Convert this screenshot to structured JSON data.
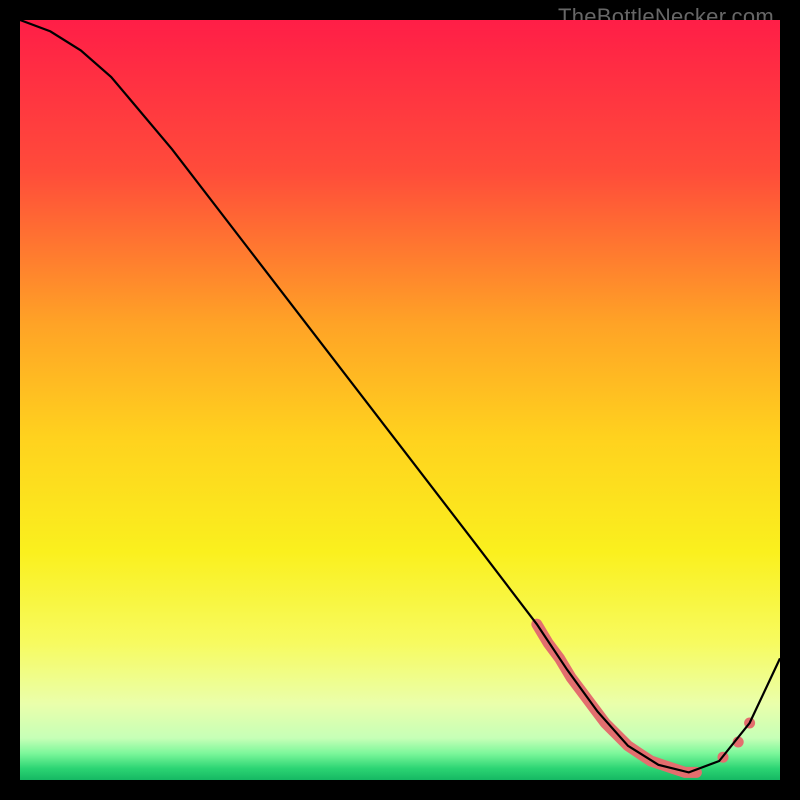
{
  "watermark": "TheBottleNecker.com",
  "chart_data": {
    "type": "line",
    "title": "",
    "xlabel": "",
    "ylabel": "",
    "xlim": [
      0,
      100
    ],
    "ylim": [
      0,
      100
    ],
    "grid": false,
    "background_gradient": {
      "stops": [
        {
          "offset": 0.0,
          "color": "#ff1e47"
        },
        {
          "offset": 0.2,
          "color": "#ff4c3a"
        },
        {
          "offset": 0.4,
          "color": "#ffa326"
        },
        {
          "offset": 0.55,
          "color": "#ffd21e"
        },
        {
          "offset": 0.7,
          "color": "#faf01e"
        },
        {
          "offset": 0.82,
          "color": "#f7fb60"
        },
        {
          "offset": 0.9,
          "color": "#eaffab"
        },
        {
          "offset": 0.945,
          "color": "#c6ffb7"
        },
        {
          "offset": 0.965,
          "color": "#7cf79a"
        },
        {
          "offset": 0.985,
          "color": "#2bd473"
        },
        {
          "offset": 1.0,
          "color": "#15b863"
        }
      ]
    },
    "series": [
      {
        "name": "curve",
        "color": "#000000",
        "x": [
          0,
          4,
          8,
          12,
          20,
          30,
          40,
          50,
          60,
          68,
          72,
          76,
          80,
          84,
          88,
          92,
          96,
          100
        ],
        "y": [
          100,
          98.5,
          96,
          92.5,
          83,
          70,
          57,
          44,
          31,
          20.5,
          14.5,
          9,
          4.5,
          2,
          1,
          2.5,
          7.5,
          16
        ]
      }
    ],
    "markers": {
      "name": "highlight-dots",
      "color": "#e36e6e",
      "x": [
        68,
        69.5,
        71,
        72.5,
        74,
        75.5,
        77,
        78.5,
        80,
        81.5,
        83,
        84.5,
        86,
        87.5,
        89,
        92.5,
        94.5,
        96
      ],
      "y": [
        20.5,
        18,
        16,
        13.5,
        11.5,
        9.5,
        7.5,
        6,
        4.5,
        3.5,
        2.5,
        2,
        1.5,
        1,
        1,
        3,
        5,
        7.5
      ]
    }
  }
}
